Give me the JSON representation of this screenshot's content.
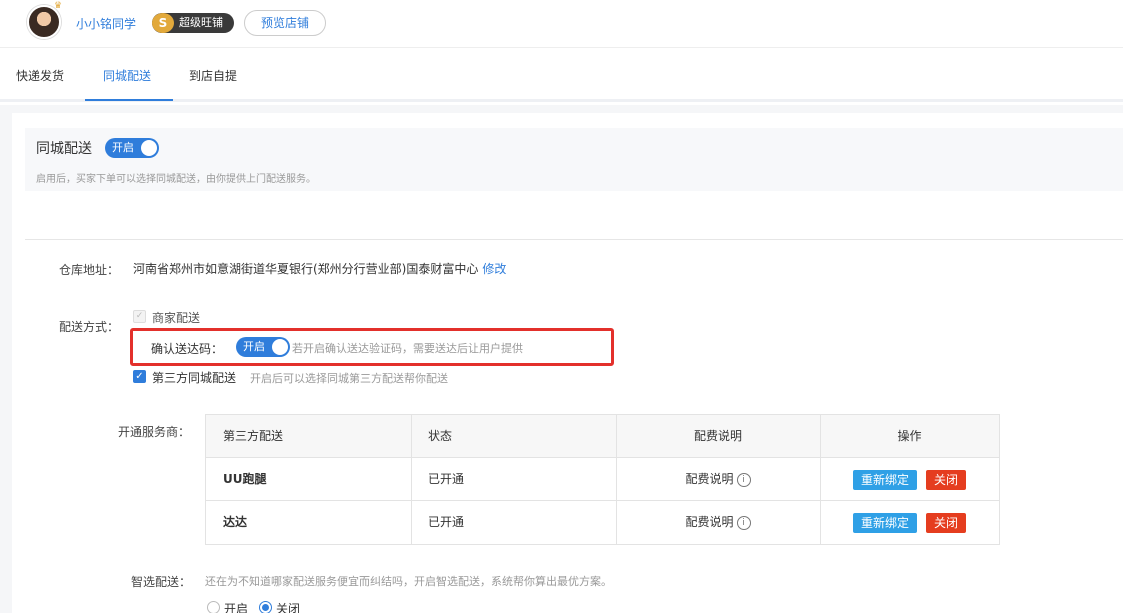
{
  "header": {
    "username": "小小铭同学",
    "vip_letter": "S",
    "vip_label": "超级旺铺",
    "preview_button": "预览店铺"
  },
  "tabs": [
    {
      "label": "快递发货",
      "active": false
    },
    {
      "label": "同城配送",
      "active": true
    },
    {
      "label": "到店自提",
      "active": false
    }
  ],
  "intro": {
    "title": "同城配送",
    "toggle_label": "开启",
    "description": "启用后，买家下单可以选择同城配送，由你提供上门配送服务。"
  },
  "warehouse": {
    "label": "仓库地址：",
    "address": "河南省郑州市如意湖街道华夏银行(郑州分行营业部)国泰财富中心",
    "edit_link": "修改"
  },
  "delivery": {
    "label": "配送方式：",
    "merchant_option": "商家配送",
    "confirm_code_label": "确认送达码：",
    "confirm_code_toggle": "开启",
    "confirm_code_hint": "若开启确认送达验证码，需要送达后让用户提供",
    "third_party_option": "第三方同城配送",
    "third_party_hint": "开启后可以选择同城第三方配送帮你配送"
  },
  "providers": {
    "label": "开通服务商：",
    "columns": [
      "第三方配送",
      "状态",
      "配费说明",
      "操作"
    ],
    "rows": [
      {
        "name": "UU跑腿",
        "status": "已开通",
        "fee": "配费说明",
        "rebind": "重新绑定",
        "close": "关闭"
      },
      {
        "name": "达达",
        "status": "已开通",
        "fee": "配费说明",
        "rebind": "重新绑定",
        "close": "关闭"
      }
    ]
  },
  "smart": {
    "label": "智选配送：",
    "description": "还在为不知道哪家配送服务便宜而纠结吗，开启智选配送，系统帮你算出最优方案。",
    "option_on": "开启",
    "option_off": "关闭",
    "selected": "关闭"
  },
  "colors": {
    "accent": "#2f7ddb",
    "highlight_border": "#e3302b",
    "rebind_button": "#2fa0e6",
    "close_button": "#e53d1f"
  },
  "icons": {
    "info": "info-circle-icon",
    "check": "check-icon",
    "crown": "crown-icon"
  }
}
